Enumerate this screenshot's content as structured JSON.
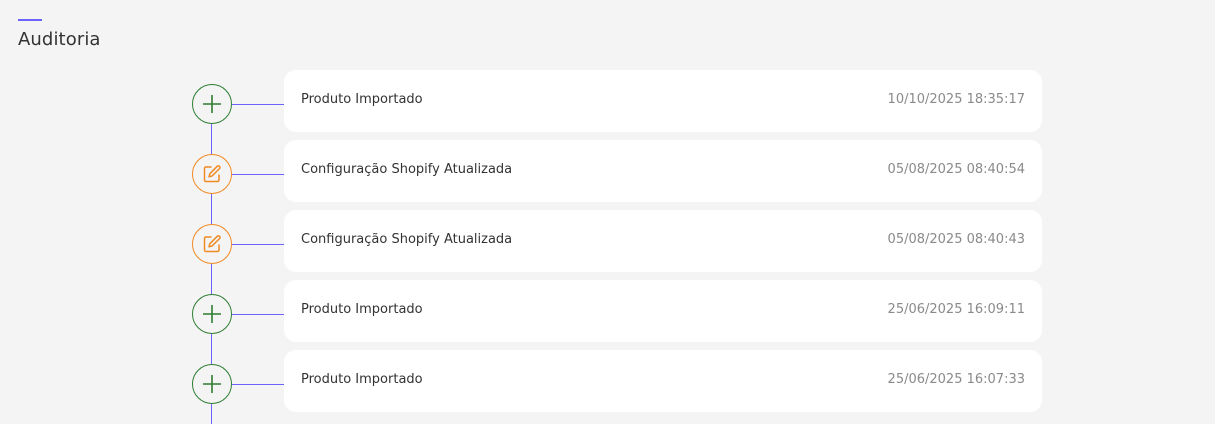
{
  "header": {
    "title": "Auditoria"
  },
  "colors": {
    "accent": "#6c63ff",
    "created": "#2e7d32",
    "updated": "#f08a24"
  },
  "events": [
    {
      "icon": "plus-icon",
      "label": "Produto Importado",
      "timestamp": "10/10/2025 18:35:17"
    },
    {
      "icon": "edit-icon",
      "label": "Configuração Shopify Atualizada",
      "timestamp": "05/08/2025 08:40:54"
    },
    {
      "icon": "edit-icon",
      "label": "Configuração Shopify Atualizada",
      "timestamp": "05/08/2025 08:40:43"
    },
    {
      "icon": "plus-icon",
      "label": "Produto Importado",
      "timestamp": "25/06/2025 16:09:11"
    },
    {
      "icon": "plus-icon",
      "label": "Produto Importado",
      "timestamp": "25/06/2025 16:07:33"
    }
  ]
}
